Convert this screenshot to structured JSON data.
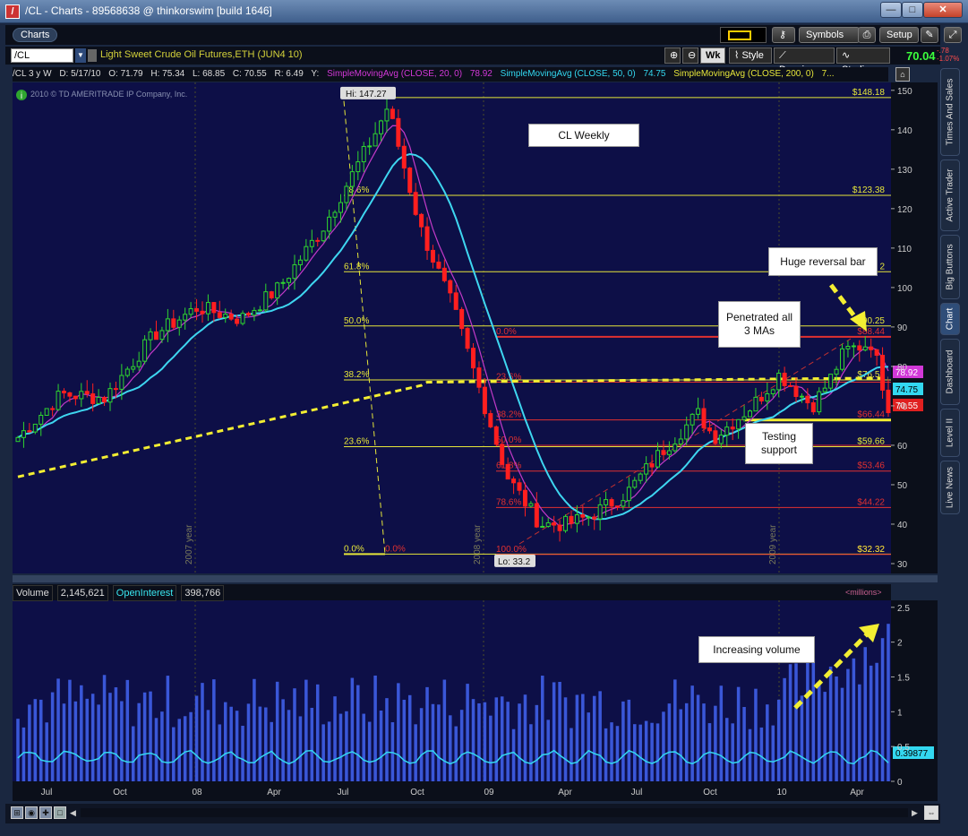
{
  "window": {
    "title": "/CL - Charts - 89568638 @ thinkorswim [build 1646]",
    "app_icon": "thinkorswim-icon",
    "buttons": [
      "minimize-icon",
      "maximize-icon",
      "close-icon"
    ]
  },
  "toolbar": {
    "charts_tab": "Charts",
    "symbols_label": "Symbols",
    "setup_label": "Setup",
    "color_swatch": "#ffcc00"
  },
  "symbol_bar": {
    "symbol": "/CL",
    "description": "Light Sweet Crude Oil Futures,ETH (JUN4 10)",
    "aggregation": "Wk",
    "style_label": "Style",
    "drawings_label": "Drawings",
    "studies_label": "Studies",
    "last_price": "70.04",
    "change": "-.78",
    "change_pct": "-1.07%"
  },
  "study_bar": {
    "symbol_period": "/CL 3 y W",
    "date": "D: 5/17/10",
    "open": "O: 71.79",
    "high": "H: 75.34",
    "low": "L: 68.85",
    "close": "C: 70.55",
    "range": "R: 6.49",
    "y": "Y:",
    "sma20_label": "SimpleMovingAvg (CLOSE, 20, 0)",
    "sma20_value": "78.92",
    "sma50_label": "SimpleMovingAvg (CLOSE, 50, 0)",
    "sma50_value": "74.75",
    "sma200_label": "SimpleMovingAvg (CLOSE, 200, 0)",
    "sma200_value": "7...",
    "copyright": "2010 © TD AMERITRADE IP Company, Inc."
  },
  "right_tabs": [
    "Times And Sales",
    "Active Trader",
    "Big Buttons",
    "Chart",
    "Dashboard",
    "Level II",
    "Live News"
  ],
  "annotations": {
    "title_box": "CL Weekly",
    "reversal": "Huge reversal bar",
    "penetrated_line1": "Penetrated all",
    "penetrated_line2": "3 MAs",
    "testing_line1": "Testing",
    "testing_line2": "support",
    "increasing_volume": "Increasing volume",
    "hi_label": "Hi: 147.27",
    "lo_label": "Lo: 33.2",
    "year_2007": "2007 year",
    "year_2008": "2008 year",
    "year_2009": "2009 year"
  },
  "volume_header": {
    "volume_label": "Volume",
    "volume_value": "2,145,621",
    "oi_label": "OpenInterest",
    "oi_value": "398,766",
    "millions": "<millions>",
    "oi_badge": "0.39877"
  },
  "colors": {
    "background": "#0d0f47",
    "bull_candle": "#2fd52f",
    "bear_candle": "#ff1f1f",
    "sma20": "#c23ac8",
    "sma50": "#3ed6f0",
    "sma200": "#f3ee32",
    "fib_yellow": "#e6e63a",
    "fib_red": "#e03030",
    "volume_bar": "#3a57d8",
    "oi_line": "#33d8f0"
  },
  "chart_data": {
    "type": "candlestick",
    "title": "",
    "price_axis": {
      "ticks": [
        30,
        40,
        50,
        60,
        70,
        80,
        90,
        100,
        110,
        120,
        130,
        140,
        150
      ],
      "range": [
        27.5,
        152
      ]
    },
    "volume_axis": {
      "ticks": [
        0,
        0.5,
        1,
        1.5,
        2,
        2.5
      ],
      "range": [
        0,
        2.6
      ],
      "unit": "millions"
    },
    "x_axis": {
      "labels": [
        "Jul",
        "Oct",
        "08",
        "Apr",
        "Jul",
        "Oct",
        "09",
        "Apr",
        "Jul",
        "Oct",
        "10",
        "Apr"
      ]
    },
    "price_badges": [
      {
        "label": "78.92",
        "color": "#d238d8"
      },
      {
        "label": "74.75",
        "color": "#33d8f0"
      },
      {
        "label": "70.55",
        "color": "#e02020"
      }
    ],
    "fib_set_1": {
      "color": "#e6e63a",
      "levels": [
        {
          "pct": "",
          "label": "$148.18",
          "price": 148.18
        },
        {
          "pct": "78.6%",
          "label": "$123.38",
          "price": 123.38
        },
        {
          "pct": "61.8%",
          "label": "",
          "price": 104
        },
        {
          "pct": "50.0%",
          "label": "",
          "price": 90.25
        },
        {
          "pct": "38.2%",
          "label": "$76.58",
          "price": 76.58
        },
        {
          "pct": "23.6%",
          "label": "$59.66",
          "price": 59.66
        },
        {
          "pct": "0.0%",
          "label": "",
          "price": 32.4
        }
      ]
    },
    "fib_set_2": {
      "color": "#e03030",
      "levels": [
        {
          "pct": "0.0%",
          "label": "$88.44",
          "price": 87.5
        },
        {
          "pct": "23.6%",
          "label": "",
          "price": 76
        },
        {
          "pct": "38.2%",
          "label": "$66.44",
          "price": 66.44
        },
        {
          "pct": "50.0%",
          "label": "",
          "price": 60
        },
        {
          "pct": "61.8%",
          "label": "$53.46",
          "price": 53.46
        },
        {
          "pct": "78.6%",
          "label": "$44.22",
          "price": 44.22
        },
        {
          "pct": "100.0%",
          "label": "$32.32",
          "price": 32.32
        }
      ]
    },
    "extra_labels": [
      {
        "text": "0.0%",
        "price": 32.4,
        "color": "#e03030"
      },
      {
        "text": "$32.32",
        "price": 32.32,
        "color": "#e6e63a"
      },
      {
        "text": "90.25",
        "price": 90.25,
        "color": "#e6e63a"
      },
      {
        "text": "2",
        "price": 104,
        "color": "#e6e63a"
      }
    ]
  }
}
